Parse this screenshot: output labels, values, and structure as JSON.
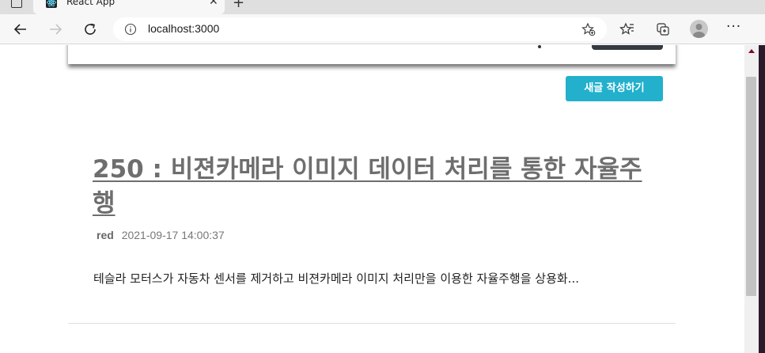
{
  "browser": {
    "tab_title": "React App",
    "tab_close": "✕",
    "new_tab": "+",
    "address": "localhost:3000",
    "more_menu": "···"
  },
  "page": {
    "write_button": "새글 작성하기",
    "post": {
      "title": "250 : 비젼카메라 이미지 데이터 처리를 통한 자율주행",
      "author": "red",
      "date": "2021-09-17 14:00:37",
      "excerpt": "테슬라 모터스가 자동차 센서를 제거하고 비젼카메라 이미지 처리만을 이용한 자율주행을 상용화..."
    }
  },
  "colors": {
    "accent_button": "#22b0cc",
    "title_text": "#6e6e6e",
    "header_button": "#343a40"
  }
}
